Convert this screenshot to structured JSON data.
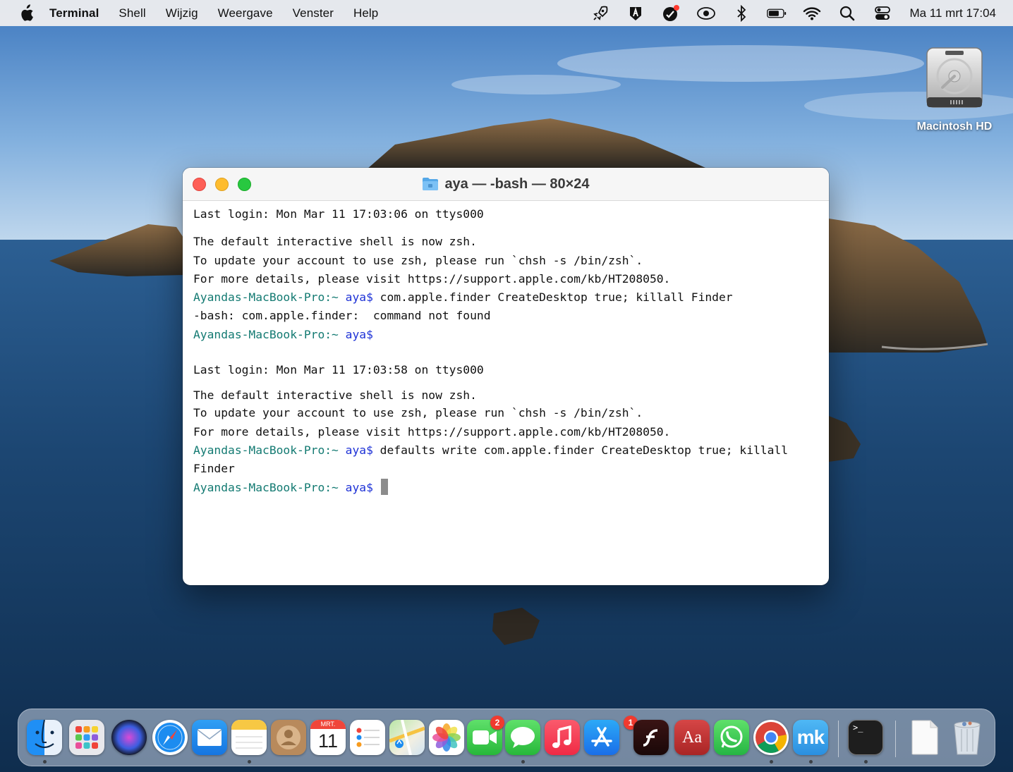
{
  "menubar": {
    "app_name": "Terminal",
    "menus": [
      "Shell",
      "Wijzig",
      "Weergave",
      "Venster",
      "Help"
    ],
    "status_icons": [
      "rocket-icon",
      "vpn-shield-icon",
      "antivirus-icon",
      "eye-icon",
      "bluetooth-icon",
      "battery-icon",
      "wifi-icon",
      "spotlight-search-icon",
      "control-center-icon"
    ],
    "clock": "Ma 11 mrt  17:04"
  },
  "desktop": {
    "drive_label": "Macintosh HD"
  },
  "terminal": {
    "title": "aya — -bash — 80×24",
    "session1": {
      "last_login": "Last login: Mon Mar 11 17:03:06 on ttys000",
      "notice": [
        "The default interactive shell is now zsh.",
        "To update your account to use zsh, please run `chsh -s /bin/zsh`.",
        "For more details, please visit https://support.apple.com/kb/HT208050."
      ],
      "prompt_host": "Ayandas-MacBook-Pro:~ ",
      "prompt_user": "aya$",
      "command": " com.apple.finder CreateDesktop true; killall Finder",
      "error": "-bash: com.apple.finder:  command not found"
    },
    "session2": {
      "last_login": "Last login: Mon Mar 11 17:03:58 on ttys000",
      "notice": [
        "The default interactive shell is now zsh.",
        "To update your account to use zsh, please run `chsh -s /bin/zsh`.",
        "For more details, please visit https://support.apple.com/kb/HT208050."
      ],
      "prompt_host": "Ayandas-MacBook-Pro:~ ",
      "prompt_user": "aya$",
      "command": " defaults write com.apple.finder CreateDesktop true; killall",
      "command_wrap": "Finder"
    }
  },
  "dock": {
    "calendar_month": "MRT.",
    "calendar_day": "11",
    "facetime_badge": "2",
    "appstore_badge": "1",
    "dictionary_text": "Aa",
    "mk_text": "mk",
    "terminal_text": ">_"
  },
  "colors": {
    "prompt_host": "#137a72",
    "prompt_user": "#1d31d6",
    "close": "#fe5f57",
    "minimize": "#febc2e",
    "zoom": "#28c840"
  }
}
